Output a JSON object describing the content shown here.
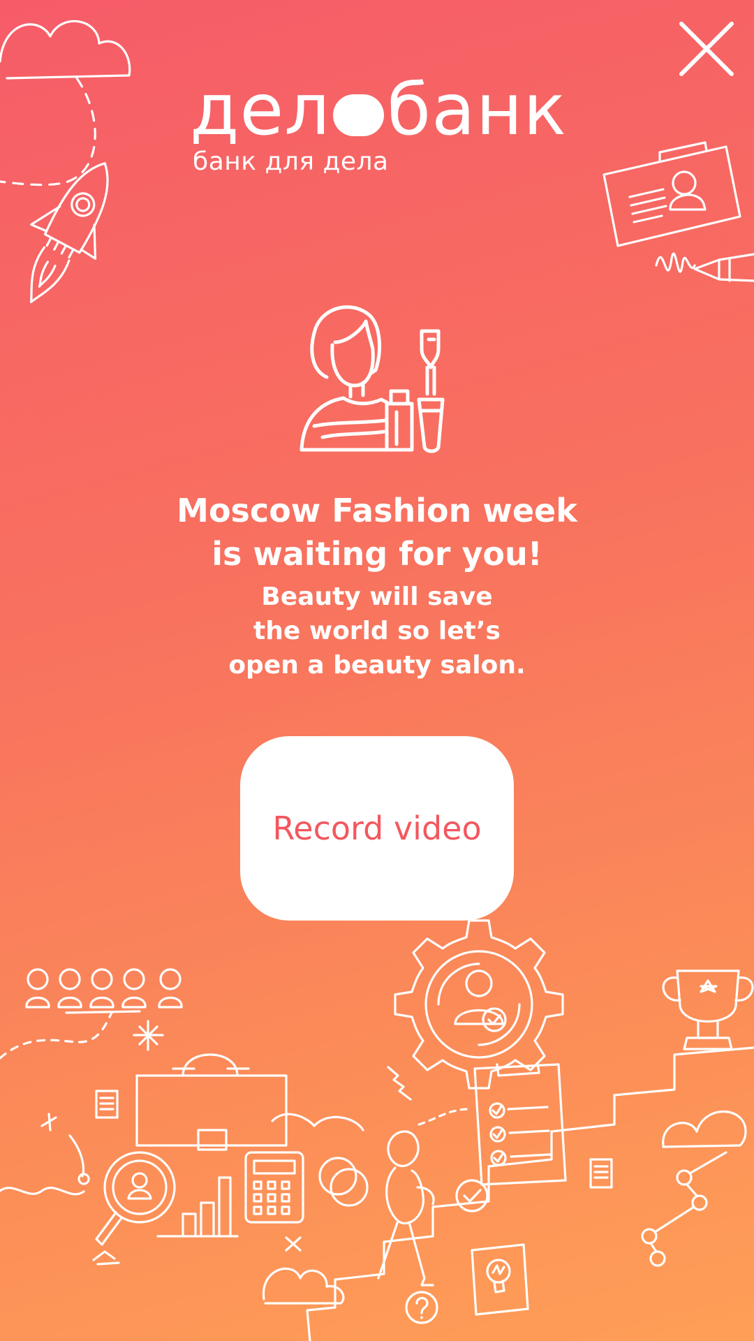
{
  "brand": {
    "logo_left": "дел",
    "logo_right": "банк",
    "tagline": "банк для дела"
  },
  "promo": {
    "title_line1": "Moscow Fashion week",
    "title_line2": "is waiting for you!",
    "subtitle_line1": "Beauty will save",
    "subtitle_line2": "the world so let’s",
    "subtitle_line3": "open a beauty salon."
  },
  "cta": {
    "record_label": "Record video"
  },
  "icons": {
    "close": "close-icon",
    "hero": "beauty-salon-icon"
  },
  "colors": {
    "gradient_top": "#f65c68",
    "gradient_bottom": "#ff9f57",
    "button_text": "#f2585f",
    "foreground": "#ffffff"
  }
}
